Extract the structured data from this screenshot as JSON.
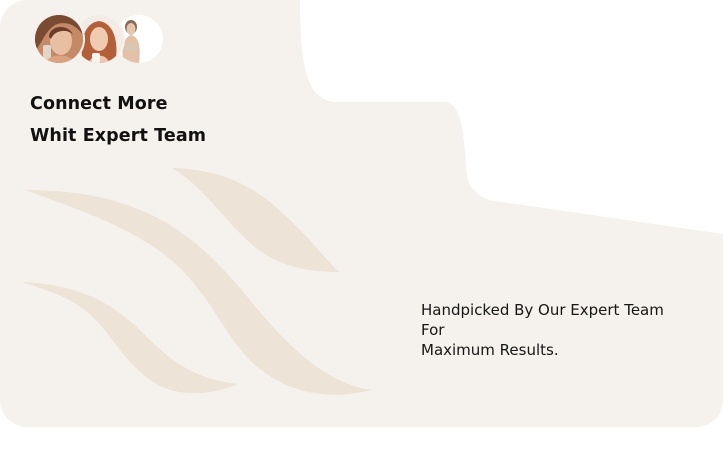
{
  "section": {
    "heading_line1": "Connect More",
    "heading_line2": "Whit Expert Team",
    "description_line1": "Handpicked By Our Expert Team",
    "description_line2": "For",
    "description_line3": "Maximum Results."
  },
  "avatars": [
    {
      "name": "expert-1",
      "icon": "woman-portrait"
    },
    {
      "name": "expert-2",
      "icon": "woman-portrait"
    },
    {
      "name": "expert-3",
      "icon": "woman-portrait"
    }
  ],
  "colors": {
    "card_background": "#f5f1ec",
    "decor_stroke": "#ede3d6",
    "text": "#111111",
    "page_background": "#ffffff"
  }
}
